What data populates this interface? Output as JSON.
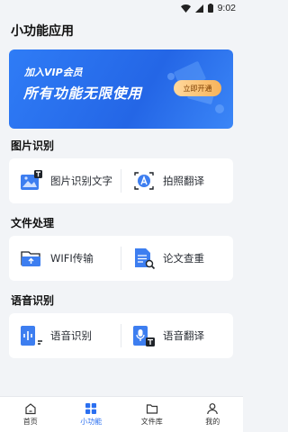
{
  "status": {
    "time": "9:02"
  },
  "appbar": {
    "title": "小功能应用"
  },
  "banner": {
    "subtitle": "加入VIP会员",
    "headline": "所有功能无限使用",
    "button": "立即开通"
  },
  "sections": [
    {
      "title": "图片识别",
      "items": [
        {
          "label": "图片识别文字"
        },
        {
          "label": "拍照翻译"
        }
      ]
    },
    {
      "title": "文件处理",
      "items": [
        {
          "label": "WIFI传输"
        },
        {
          "label": "论文查重"
        }
      ]
    },
    {
      "title": "语音识别",
      "items": [
        {
          "label": "语音识别"
        },
        {
          "label": "语音翻译"
        }
      ]
    }
  ],
  "tabs": [
    {
      "label": "首页",
      "icon": "home-icon"
    },
    {
      "label": "小功能",
      "icon": "grid-icon",
      "active": true
    },
    {
      "label": "文件库",
      "icon": "folder-icon"
    },
    {
      "label": "我的",
      "icon": "user-icon"
    }
  ],
  "colors": {
    "accent": "#2a6ff0",
    "banner": "#2466e6",
    "iconBlue": "#3d7ef0"
  }
}
